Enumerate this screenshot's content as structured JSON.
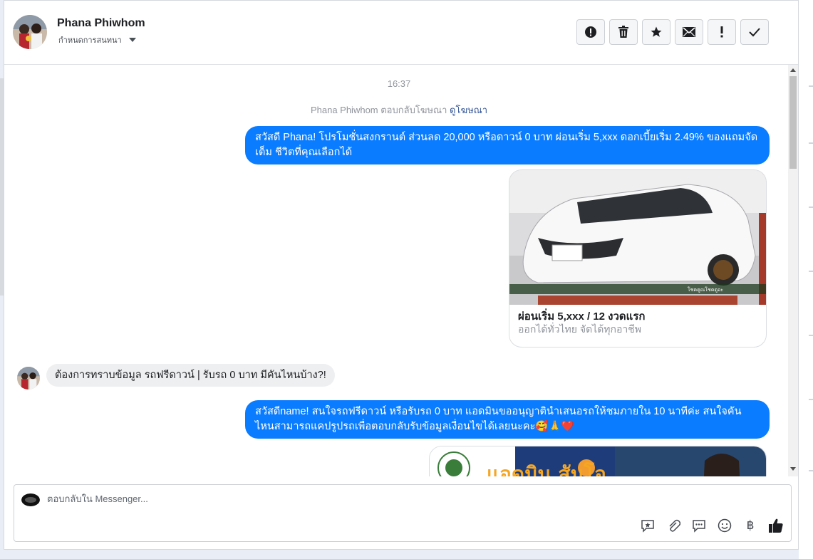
{
  "header": {
    "contact_name": "Phana Phiwhom",
    "conversation_menu": "กำหนดการสนทนา",
    "toolbar": [
      {
        "name": "report-icon",
        "glyph": "!"
      },
      {
        "name": "trash-icon",
        "glyph": "🗑"
      },
      {
        "name": "star-icon",
        "glyph": "★"
      },
      {
        "name": "envelope-icon",
        "glyph": "✉"
      },
      {
        "name": "exclamation-icon",
        "glyph": "!"
      },
      {
        "name": "checkmark-icon",
        "glyph": "✓"
      }
    ]
  },
  "chat": {
    "time": "16:37",
    "reply_note_prefix": "Phana Phiwhom ตอบกลับโฆษณา",
    "reply_note_link": "ดูโฆษณา",
    "messages": [
      {
        "text": "สวัสดี Phana! โปรโมชั่นสงกรานต์ ส่วนลด 20,000 หรือดาวน์ 0 บาท ผ่อนเริ่ม 5,xxx ดอกเบี้ยเริ่ม 2.49% ของแถมจัดเต็ม ชีวิตที่คุณเลือกได้"
      },
      {
        "text": "ต้องการทราบข้อมูล รถฟรีดาวน์ | รับรถ 0 บาท มีคันไหนบ้าง?!"
      },
      {
        "text": "สวัสดีname! สนใจรถฟรีดาวน์ หรือรับรถ 0 บาท แอดมินขออนุญาตินำเสนอรถให้ชมภายใน 10 นาทีค่ะ สนใจคันไหนสามารถแคปรูปรถเพื่อตอบกลับรับข้อมูลเงื่อนไขได้เลยนะคะ🥰🙏❤️"
      }
    ],
    "ad_card": {
      "title": "ผ่อนเริ่ม 5,xxx / 12 งวดแรก",
      "subtitle": "ออกได้ทั่วไทย จัดได้ทุกอาชีพ",
      "image_caption": "โชคคูณโชคดูอะ"
    },
    "ad_banner_text": "แอดมิน สัมโอ"
  },
  "composer": {
    "placeholder": "ตอบกลับใน Messenger...",
    "actions": [
      {
        "name": "sticker-reply-icon",
        "glyph": "✦"
      },
      {
        "name": "attach-icon",
        "glyph": "📎"
      },
      {
        "name": "saved-reply-icon",
        "glyph": "💬"
      },
      {
        "name": "emoji-icon",
        "glyph": "☺"
      },
      {
        "name": "baht-icon",
        "glyph": "฿"
      },
      {
        "name": "thumbs-up-icon",
        "glyph": "👍"
      }
    ]
  },
  "colors": {
    "accent": "#0a7cff",
    "incoming_bubble": "#eeeff1",
    "link": "#385898"
  }
}
